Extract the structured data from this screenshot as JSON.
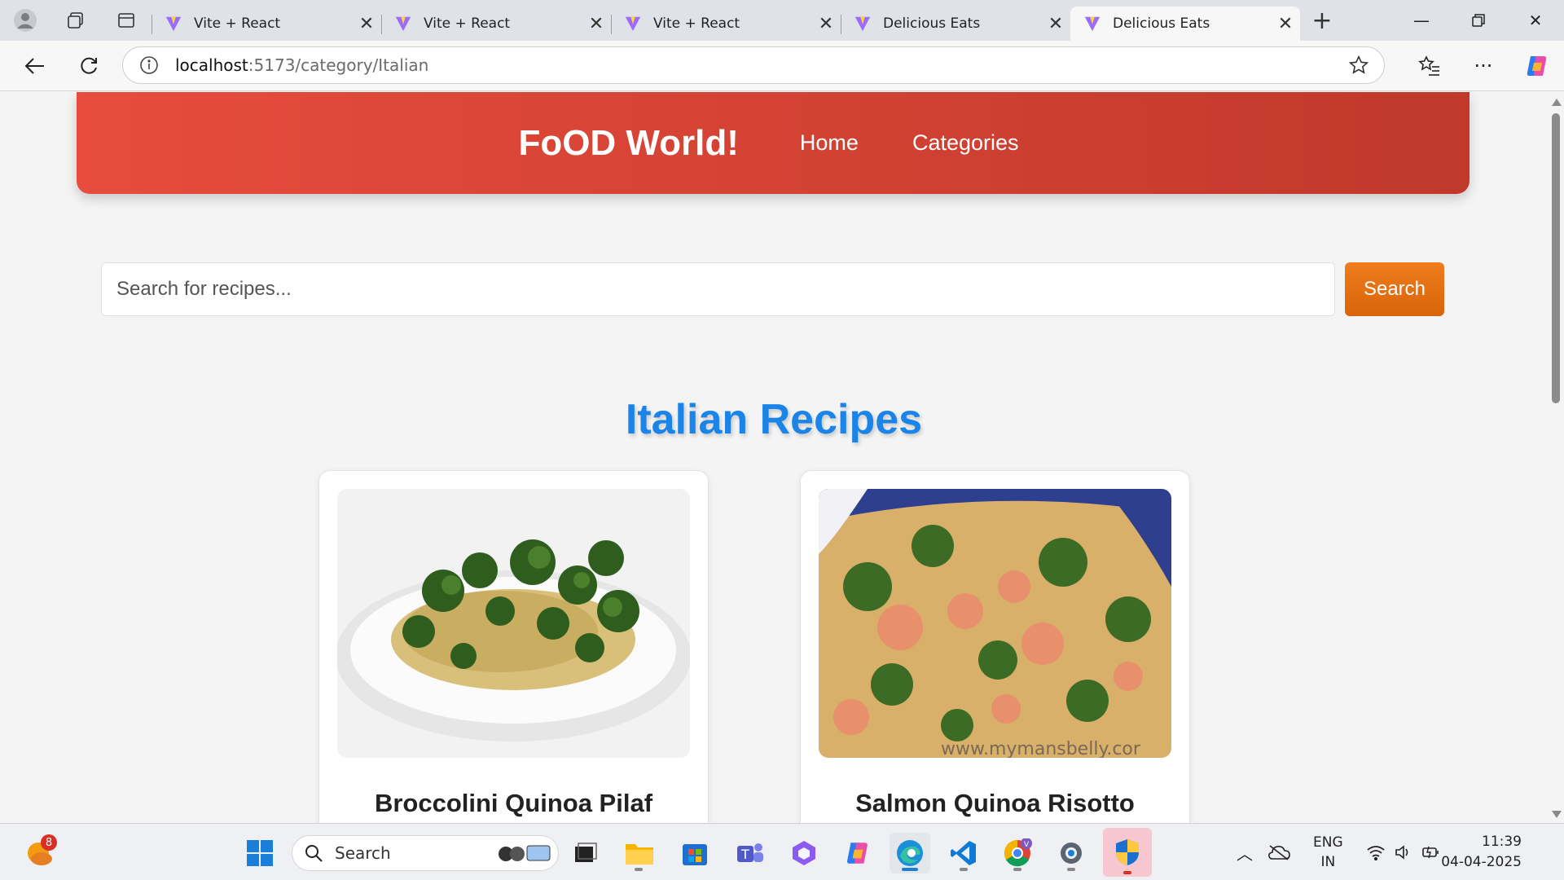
{
  "browser": {
    "tabs": [
      {
        "title": "Vite + React",
        "active": false
      },
      {
        "title": "Vite + React",
        "active": false
      },
      {
        "title": "Vite + React",
        "active": false
      },
      {
        "title": "Delicious Eats",
        "active": false
      },
      {
        "title": "Delicious Eats",
        "active": true
      }
    ],
    "url_host": "localhost",
    "url_path": ":5173/category/Italian"
  },
  "site": {
    "brand": "FoOD World!",
    "nav": [
      "Home",
      "Categories"
    ],
    "search_placeholder": "Search for recipes...",
    "search_button": "Search",
    "section_title": "Italian Recipes",
    "recipes": [
      {
        "name": "Broccolini Quinoa Pilaf",
        "image": "plate of quinoa with broccolini"
      },
      {
        "name": "Salmon Quinoa Risotto",
        "image": "quinoa with salmon and kale",
        "watermark": "www.mymansbelly.cor"
      }
    ]
  },
  "taskbar": {
    "weather_badge": "8",
    "search_label": "Search",
    "lang_top": "ENG",
    "lang_bottom": "IN",
    "time": "11:39",
    "date": "04-04-2025"
  },
  "colors": {
    "header_start": "#e74c3c",
    "header_end": "#c0392b",
    "title_blue": "#1b84e8",
    "search_orange": "#e3700f"
  }
}
